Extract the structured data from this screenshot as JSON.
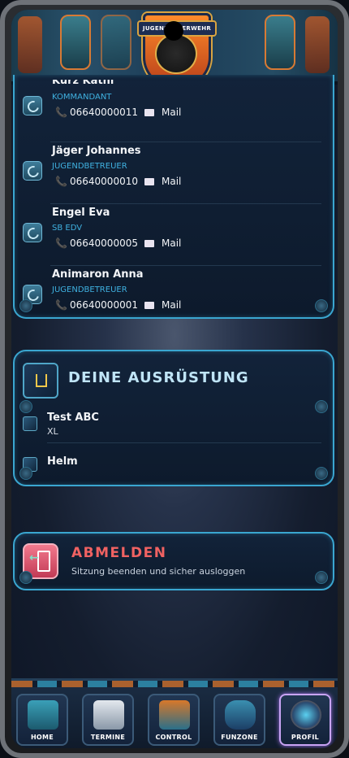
{
  "header": {
    "logo_text": "JUGENDFEUERWEHR"
  },
  "contacts": [
    {
      "name": "Kurz Kathi",
      "role": "KOMMANDANT",
      "phone": "06640000011",
      "mail_label": "Mail"
    },
    {
      "name": "Jäger Johannes",
      "role": "JUGENDBETREUER",
      "phone": "06640000010",
      "mail_label": "Mail"
    },
    {
      "name": "Engel Eva",
      "role": "SB EDV",
      "phone": "06640000005",
      "mail_label": "Mail"
    },
    {
      "name": "Animaron Anna",
      "role": "JUGENDBETREUER",
      "phone": "06640000001",
      "mail_label": "Mail"
    }
  ],
  "equipment": {
    "title": "DEINE AUSRÜSTUNG",
    "items": [
      {
        "name": "Test ABC",
        "size": "XL"
      },
      {
        "name": "Helm",
        "size": ""
      }
    ]
  },
  "logout": {
    "title": "ABMELDEN",
    "subtitle": "Sitzung beenden und sicher ausloggen"
  },
  "nav": [
    {
      "label": "HOME",
      "icon": "home-icon"
    },
    {
      "label": "TERMINE",
      "icon": "calendar-icon"
    },
    {
      "label": "CONTROL",
      "icon": "control-panel-icon"
    },
    {
      "label": "FUNZONE",
      "icon": "gamepad-icon"
    },
    {
      "label": "PROFIL",
      "icon": "profile-robot-icon",
      "active": true
    }
  ],
  "colors": {
    "accent": "#3aa6d0",
    "role": "#3fb1e0",
    "logout": "#f06262",
    "phone_icon": "#e0467a"
  }
}
